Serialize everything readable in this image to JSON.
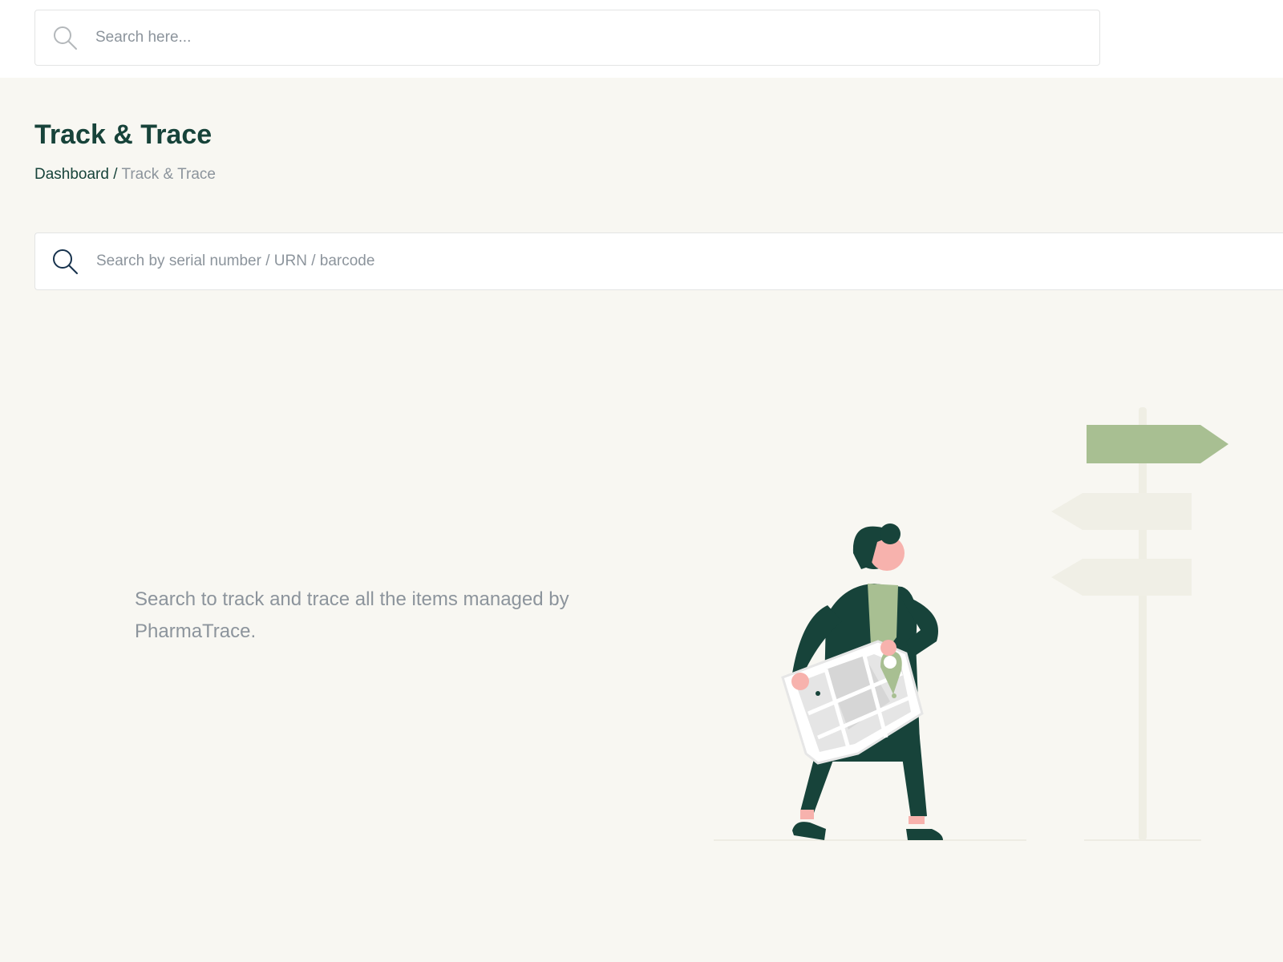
{
  "global_search": {
    "placeholder": "Search here...",
    "icon": "search-icon"
  },
  "page": {
    "title": "Track & Trace"
  },
  "breadcrumb": {
    "root": "Dashboard",
    "separator": "/",
    "current": "Track & Trace"
  },
  "trace_search": {
    "placeholder": "Search by serial number / URN / barcode",
    "icon": "search-icon"
  },
  "empty_state": {
    "message": "Search to track and trace all the items managed by PharmaTrace.",
    "illustration": "person-with-map-at-signpost"
  },
  "colors": {
    "background": "#f8f7f2",
    "brand_dark_green": "#17433a",
    "accent_sage": "#a8bf92",
    "muted_text": "#8c949c"
  }
}
